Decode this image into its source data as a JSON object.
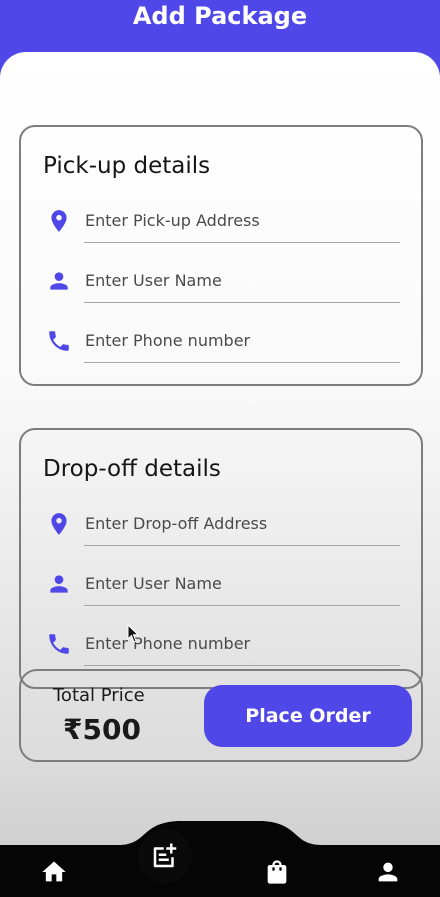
{
  "header": {
    "title": "Add Package"
  },
  "pickup": {
    "title": "Pick-up details",
    "fields": [
      {
        "icon": "location-pin-icon",
        "placeholder": "Enter Pick-up Address"
      },
      {
        "icon": "person-icon",
        "placeholder": "Enter User Name"
      },
      {
        "icon": "phone-icon",
        "placeholder": "Enter Phone number"
      }
    ]
  },
  "dropoff": {
    "title": "Drop-off details",
    "fields": [
      {
        "icon": "location-pin-icon",
        "placeholder": "Enter Drop-off Address"
      },
      {
        "icon": "person-icon",
        "placeholder": "Enter User Name"
      },
      {
        "icon": "phone-icon",
        "placeholder": "Enter Phone number"
      }
    ]
  },
  "order": {
    "total_label": "Total Price",
    "total_value": "₹500",
    "button_label": "Place Order"
  },
  "bottom_nav": {
    "items": [
      {
        "icon": "home-icon"
      },
      {
        "icon": "add-note-icon",
        "active": true
      },
      {
        "icon": "shopping-bag-icon"
      },
      {
        "icon": "profile-icon"
      }
    ]
  },
  "colors": {
    "accent": "#4f47e8",
    "nav_bg": "#050505",
    "border": "#7d7d7d"
  }
}
